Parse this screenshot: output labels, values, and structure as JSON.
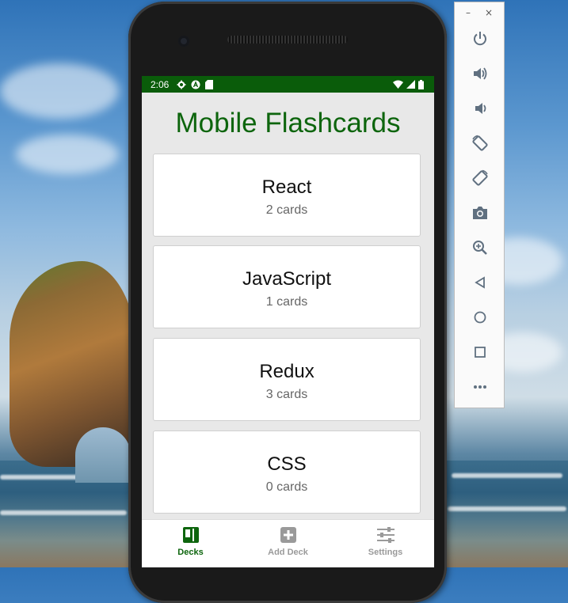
{
  "emulator_panel": {
    "minimize_label": "–",
    "close_label": "×",
    "buttons": [
      {
        "icon": "power-icon"
      },
      {
        "icon": "volume-up-icon"
      },
      {
        "icon": "volume-down-icon"
      },
      {
        "icon": "rotate-left-icon"
      },
      {
        "icon": "rotate-right-icon"
      },
      {
        "icon": "camera-icon"
      },
      {
        "icon": "zoom-icon"
      },
      {
        "icon": "back-icon"
      },
      {
        "icon": "home-icon"
      },
      {
        "icon": "overview-icon"
      },
      {
        "icon": "more-icon"
      }
    ],
    "icon_color": "#607080"
  },
  "status_bar": {
    "time": "2:06",
    "color": "#0a5c0a"
  },
  "app": {
    "title": "Mobile Flashcards",
    "accent_color": "#0d650d",
    "decks": [
      {
        "title": "React",
        "count": "2 cards"
      },
      {
        "title": "JavaScript",
        "count": "1 cards"
      },
      {
        "title": "Redux",
        "count": "3 cards"
      },
      {
        "title": "CSS",
        "count": "0 cards"
      }
    ],
    "tabs": [
      {
        "label": "Decks",
        "icon": "deck-icon",
        "active": true
      },
      {
        "label": "Add Deck",
        "icon": "plus-box-icon",
        "active": false
      },
      {
        "label": "Settings",
        "icon": "sliders-icon",
        "active": false
      }
    ]
  }
}
